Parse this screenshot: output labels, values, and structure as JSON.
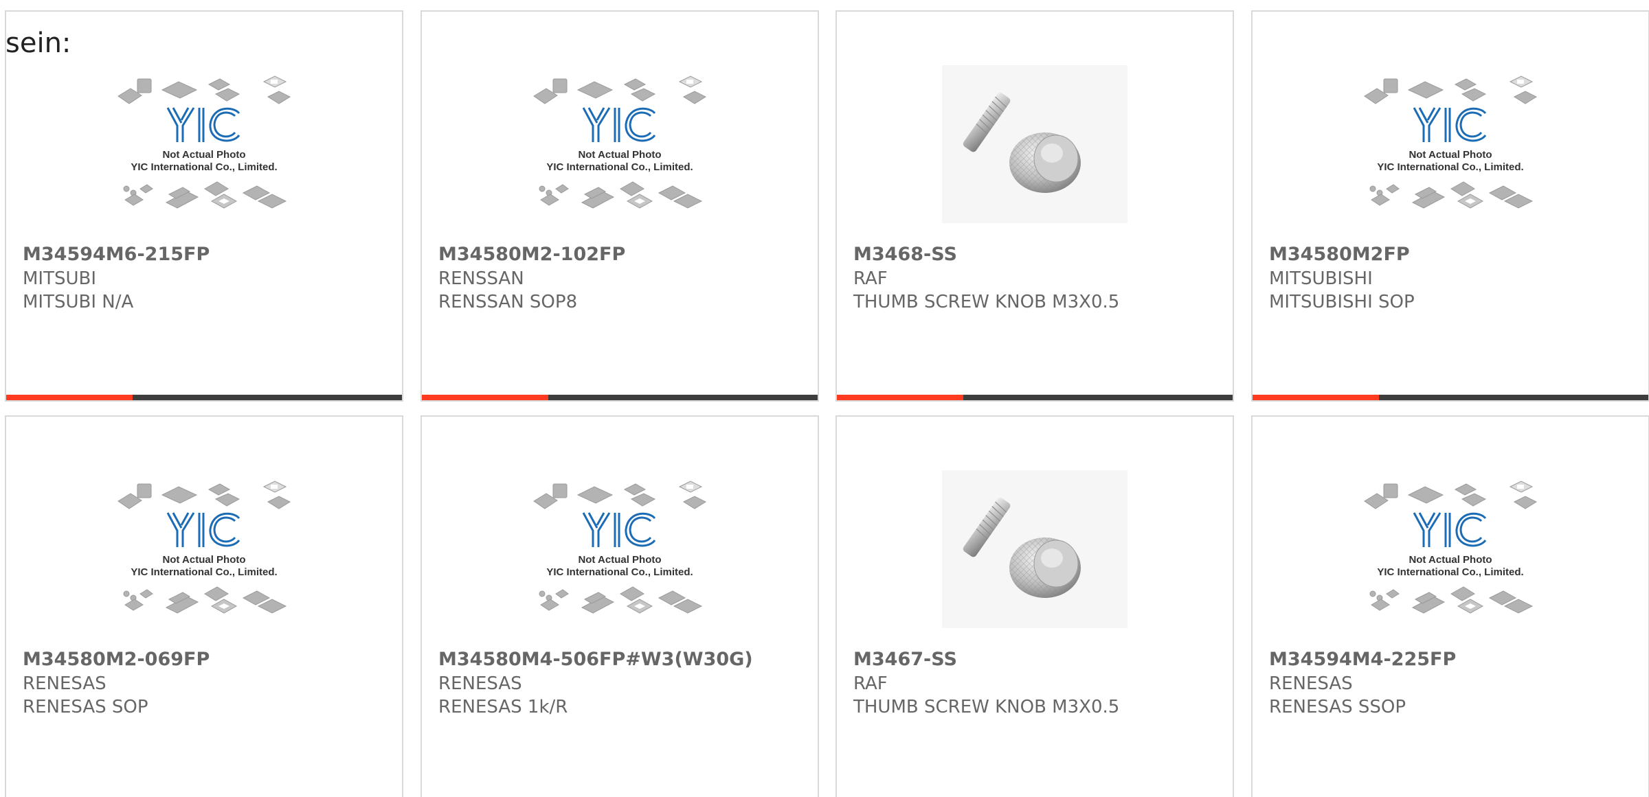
{
  "heading": "sein:",
  "colors": {
    "bar_accent": "#ff3b1f",
    "bar_rest": "#3d3d3d",
    "text": "#666666",
    "logo_blue": "#1c6cb5"
  },
  "placeholder": {
    "line1": "Not Actual Photo",
    "line2": "YIC International Co., Limited.",
    "logo": "YIC"
  },
  "products": [
    {
      "part": "M34594M6-215FP",
      "maker": "MITSUBI",
      "desc": "MITSUBI N/A",
      "image": "placeholder-chips"
    },
    {
      "part": "M34580M2-102FP",
      "maker": "RENSSAN",
      "desc": "RENSSAN SOP8",
      "image": "placeholder-chips"
    },
    {
      "part": "M3468-SS",
      "maker": "RAF",
      "desc": "THUMB SCREW KNOB M3X0.5",
      "image": "thumb-screw-photo"
    },
    {
      "part": "M34580M2FP",
      "maker": "MITSUBISHI",
      "desc": "MITSUBISHI SOP",
      "image": "placeholder-chips"
    },
    {
      "part": "M34580M2-069FP",
      "maker": "RENESAS",
      "desc": "RENESAS SOP",
      "image": "placeholder-chips"
    },
    {
      "part": "M34580M4-506FP#W3(W30G)",
      "maker": "RENESAS",
      "desc": "RENESAS 1k/R",
      "image": "placeholder-chips"
    },
    {
      "part": "M3467-SS",
      "maker": "RAF",
      "desc": "THUMB SCREW KNOB M3X0.5",
      "image": "thumb-screw-photo"
    },
    {
      "part": "M34594M4-225FP",
      "maker": "RENESAS",
      "desc": "RENESAS SSOP",
      "image": "placeholder-chips"
    }
  ]
}
